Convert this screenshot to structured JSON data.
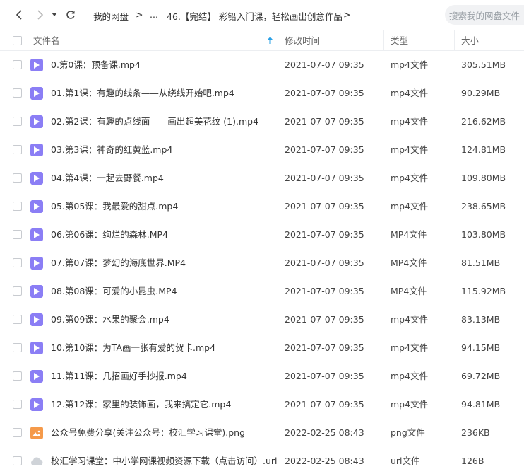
{
  "toolbar": {
    "breadcrumb": [
      "我的网盘",
      ">",
      "...",
      "46.【完结】 彩铅入门课，轻松画出创意作品",
      ">"
    ],
    "search_placeholder": "搜索我的网盘文件"
  },
  "header": {
    "name": "文件名",
    "modified": "修改时间",
    "type": "类型",
    "size": "大小"
  },
  "files": [
    {
      "icon": "video",
      "name": "0.第0课：预备课.mp4",
      "modified": "2021-07-07 09:35",
      "type": "mp4文件",
      "size": "305.51MB"
    },
    {
      "icon": "video",
      "name": "01.第1课：有趣的线条——从绕线开始吧.mp4",
      "modified": "2021-07-07 09:35",
      "type": "mp4文件",
      "size": "90.29MB"
    },
    {
      "icon": "video",
      "name": "02.第2课：有趣的点线面——画出超美花纹 (1).mp4",
      "modified": "2021-07-07 09:35",
      "type": "mp4文件",
      "size": "216.62MB"
    },
    {
      "icon": "video",
      "name": "03.第3课：神奇的红黄蓝.mp4",
      "modified": "2021-07-07 09:35",
      "type": "mp4文件",
      "size": "124.81MB"
    },
    {
      "icon": "video",
      "name": "04.第4课：一起去野餐.mp4",
      "modified": "2021-07-07 09:35",
      "type": "mp4文件",
      "size": "109.80MB"
    },
    {
      "icon": "video",
      "name": "05.第05课：我最爱的甜点.mp4",
      "modified": "2021-07-07 09:35",
      "type": "mp4文件",
      "size": "238.65MB"
    },
    {
      "icon": "video",
      "name": "06.第06课：绚烂的森林.MP4",
      "modified": "2021-07-07 09:35",
      "type": "MP4文件",
      "size": "103.80MB"
    },
    {
      "icon": "video",
      "name": "07.第07课：梦幻的海底世界.MP4",
      "modified": "2021-07-07 09:35",
      "type": "MP4文件",
      "size": "81.51MB"
    },
    {
      "icon": "video",
      "name": "08.第08课：可爱的小昆虫.MP4",
      "modified": "2021-07-07 09:35",
      "type": "MP4文件",
      "size": "115.92MB"
    },
    {
      "icon": "video",
      "name": "09.第09课：水果的聚会.mp4",
      "modified": "2021-07-07 09:35",
      "type": "mp4文件",
      "size": "83.13MB"
    },
    {
      "icon": "video",
      "name": "10.第10课：为TA画一张有爱的贺卡.mp4",
      "modified": "2021-07-07 09:35",
      "type": "mp4文件",
      "size": "94.15MB"
    },
    {
      "icon": "video",
      "name": "11.第11课：几招画好手抄报.mp4",
      "modified": "2021-07-07 09:35",
      "type": "mp4文件",
      "size": "69.72MB"
    },
    {
      "icon": "video",
      "name": "12.第12课：家里的装饰画，我来搞定它.mp4",
      "modified": "2021-07-07 09:35",
      "type": "mp4文件",
      "size": "94.81MB"
    },
    {
      "icon": "image",
      "name": "公众号免费分享(关注公众号：校汇学习课堂).png",
      "modified": "2022-02-25 08:43",
      "type": "png文件",
      "size": "236KB"
    },
    {
      "icon": "link",
      "name": "校汇学习课堂：中小学网课视频资源下载（点击访问）.url",
      "modified": "2022-02-25 08:43",
      "type": "url文件",
      "size": "126B"
    }
  ],
  "colors": {
    "video_icon": "#8b7ef5",
    "image_icon": "#f59a4a",
    "sort_arrow": "#2aa0e6"
  }
}
